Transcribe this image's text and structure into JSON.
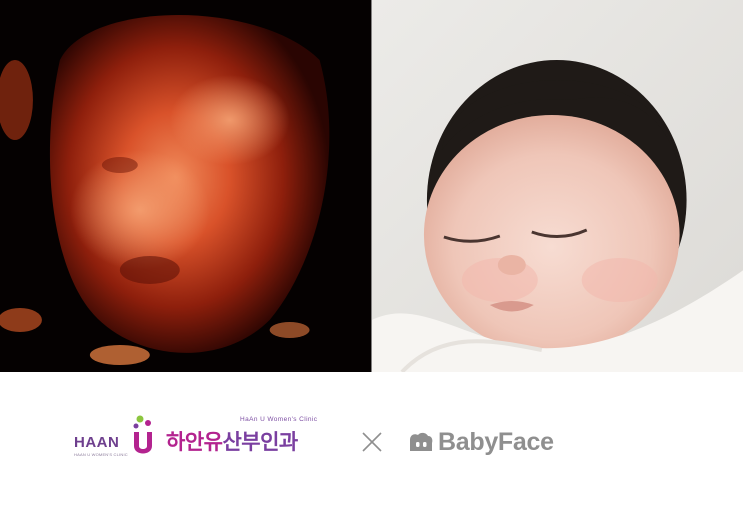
{
  "images": {
    "left": {
      "icon": "ultrasound-3d-image"
    },
    "right": {
      "icon": "newborn-baby-photo"
    }
  },
  "logos": {
    "clinic": {
      "brand_latin": "HAAN",
      "brand_sub": "HAAN U WOMEN'S CLINIC",
      "name_korean_main": "하안유",
      "name_korean_tail": "산부인과",
      "name_english": "HaAn U Women's Clinic",
      "colors": {
        "magenta": "#b3238f",
        "purple": "#7a3fa0",
        "green": "#8cc63f"
      }
    },
    "separator": "×",
    "partner": {
      "name": "BabyFace",
      "color": "#8f8f8f"
    }
  }
}
